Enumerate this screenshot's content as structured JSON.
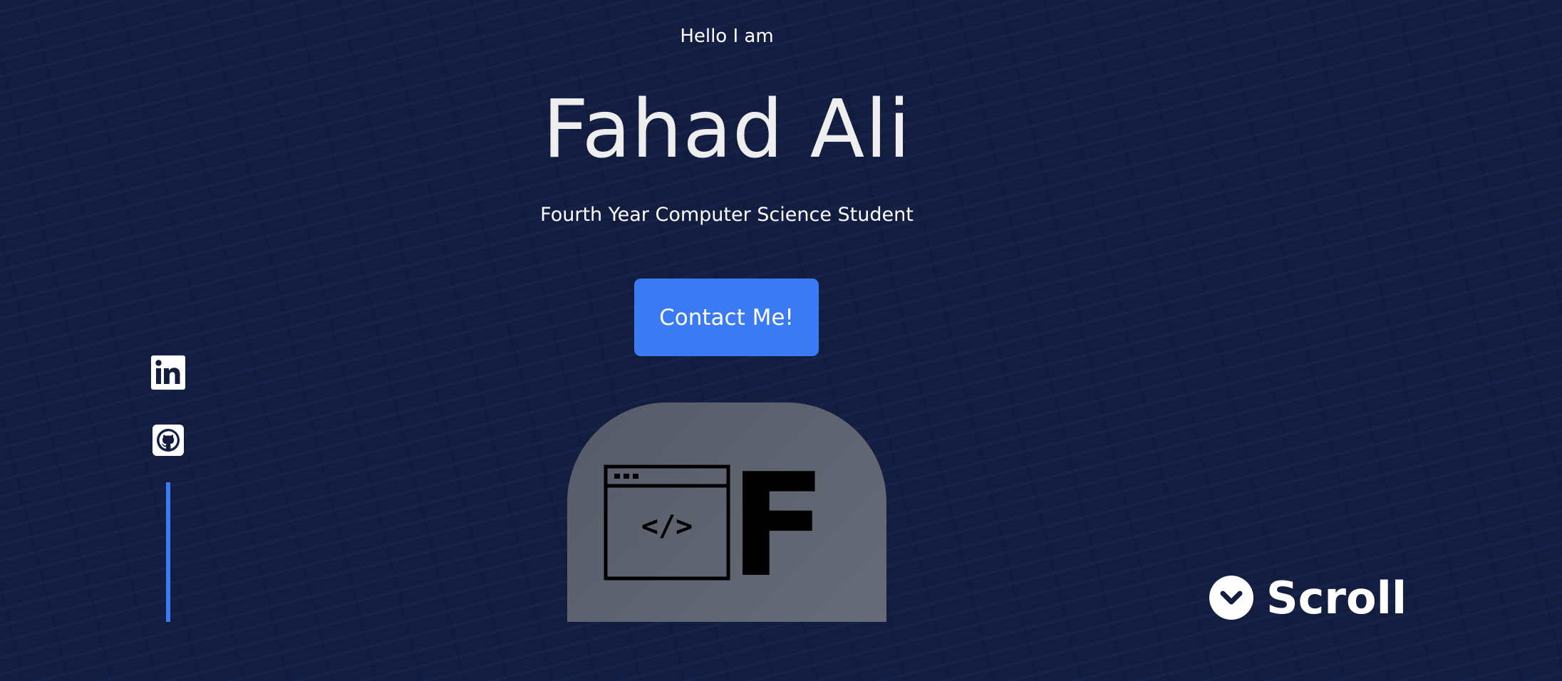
{
  "hero": {
    "greeting": "Hello I am",
    "name": "Fahad Ali",
    "subtitle": "Fourth Year Computer Science Student",
    "contact_label": "Contact Me!"
  },
  "logo": {
    "letter": "F",
    "icon": "code-window-icon",
    "code_glyph": "</>"
  },
  "socials": [
    {
      "name": "LinkedIn",
      "icon": "linkedin-icon"
    },
    {
      "name": "GitHub",
      "icon": "github-icon"
    }
  ],
  "scroll": {
    "label": "Scroll",
    "icon": "chevron-down-icon"
  },
  "colors": {
    "background": "#121d40",
    "accent": "#3a7bf3",
    "card": "#5f6470",
    "text": "#ffffff"
  }
}
